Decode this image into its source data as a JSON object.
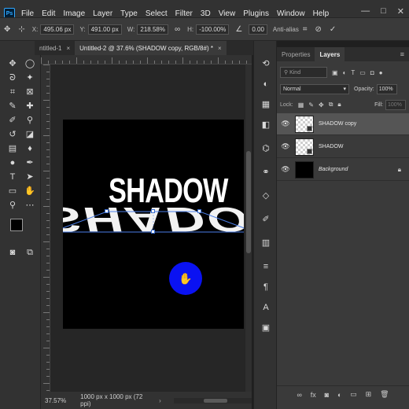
{
  "app": {
    "logo": "Ps"
  },
  "menu": [
    "File",
    "Edit",
    "Image",
    "Layer",
    "Type",
    "Select",
    "Filter",
    "3D",
    "View",
    "Plugins",
    "Window",
    "Help"
  ],
  "window_controls": [
    "—",
    "□",
    "✕"
  ],
  "options_bar": {
    "x_label": "X:",
    "x_value": "495.06 px",
    "y_label": "Y:",
    "y_value": "491.00 px",
    "w_label": "W:",
    "w_value": "218.58%",
    "h_label": "H:",
    "h_value": "-100.00%",
    "angle_value": "0.00",
    "antialias_label": "Anti-alias"
  },
  "tabs": [
    {
      "label": "ntitled-1",
      "active": false
    },
    {
      "label": "Untitled-2 @ 37.6% (SHADOW copy, RGB/8#) *",
      "active": true
    }
  ],
  "canvas": {
    "text": "SHADOW",
    "reflect_text": "SHADOW",
    "cursor_icon": "✋",
    "bg_color": "#000000",
    "cursor_color": "#0a12f2"
  },
  "status": {
    "zoom": "37.57%",
    "doc_info": "1000 px x 1000 px (72 ppi)",
    "arrow": "›"
  },
  "layers_panel": {
    "tabs": [
      {
        "label": "Properties",
        "active": false
      },
      {
        "label": "Layers",
        "active": true
      }
    ],
    "menu_icon": "≡",
    "filter_placeholder": "Kind",
    "blend_mode": "Normal",
    "opacity_label": "Opacity:",
    "opacity_value": "100%",
    "lock_label": "Lock:",
    "fill_label": "Fill:",
    "fill_value": "100%",
    "layers": [
      {
        "name": "SHADOW copy",
        "selected": true,
        "thumb": "checker"
      },
      {
        "name": "SHADOW",
        "selected": false,
        "thumb": "checker"
      },
      {
        "name": "Background",
        "selected": false,
        "thumb": "black",
        "italic": true,
        "locked": true
      }
    ]
  }
}
